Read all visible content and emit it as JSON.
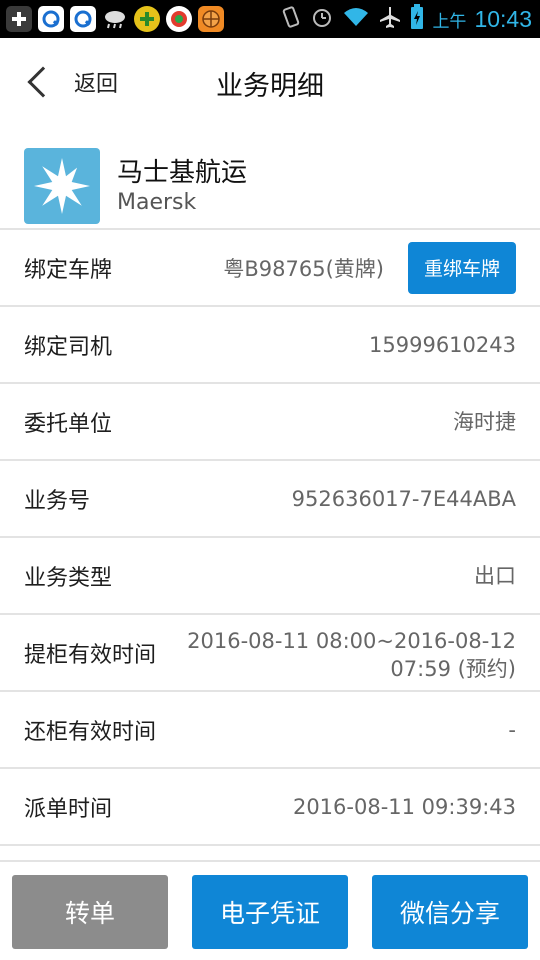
{
  "status_bar": {
    "ampm": "上午",
    "time": "10:43",
    "left_icons": [
      "add-icon",
      "q-browser-icon",
      "q-browser-icon",
      "weather-icon",
      "game-icon",
      "app-icon",
      "basketball-icon"
    ],
    "right_icons": [
      "vibrate-icon",
      "alarm-icon",
      "wifi-icon",
      "airplane-icon",
      "battery-icon"
    ]
  },
  "header": {
    "back_label": "返回",
    "title": "业务明细"
  },
  "company": {
    "name": "马士基航运",
    "name_en": "Maersk",
    "logo_color": "#5ab4dc"
  },
  "details": {
    "plate": {
      "label": "绑定车牌",
      "value": "粤B98765(黄牌)",
      "button": "重绑车牌"
    },
    "driver": {
      "label": "绑定司机",
      "value": "15999610243"
    },
    "client": {
      "label": "委托单位",
      "value": "海时捷"
    },
    "business_no": {
      "label": "业务号",
      "value": "952636017-7E44ABA"
    },
    "business_type": {
      "label": "业务类型",
      "value": "出口"
    },
    "pickup_time": {
      "label": "提柜有效时间",
      "value": "2016-08-11 08:00~2016-08-12 07:59 (预约)"
    },
    "return_time": {
      "label": "还柜有效时间",
      "value": "-"
    },
    "dispatch_time": {
      "label": "派单时间",
      "value": "2016-08-11 09:39:43"
    }
  },
  "footer": {
    "transfer": "转单",
    "voucher": "电子凭证",
    "share": "微信分享"
  },
  "colors": {
    "accent": "#0f86d6",
    "disabled": "#8c8c8c",
    "status_accent": "#31b6e7"
  }
}
